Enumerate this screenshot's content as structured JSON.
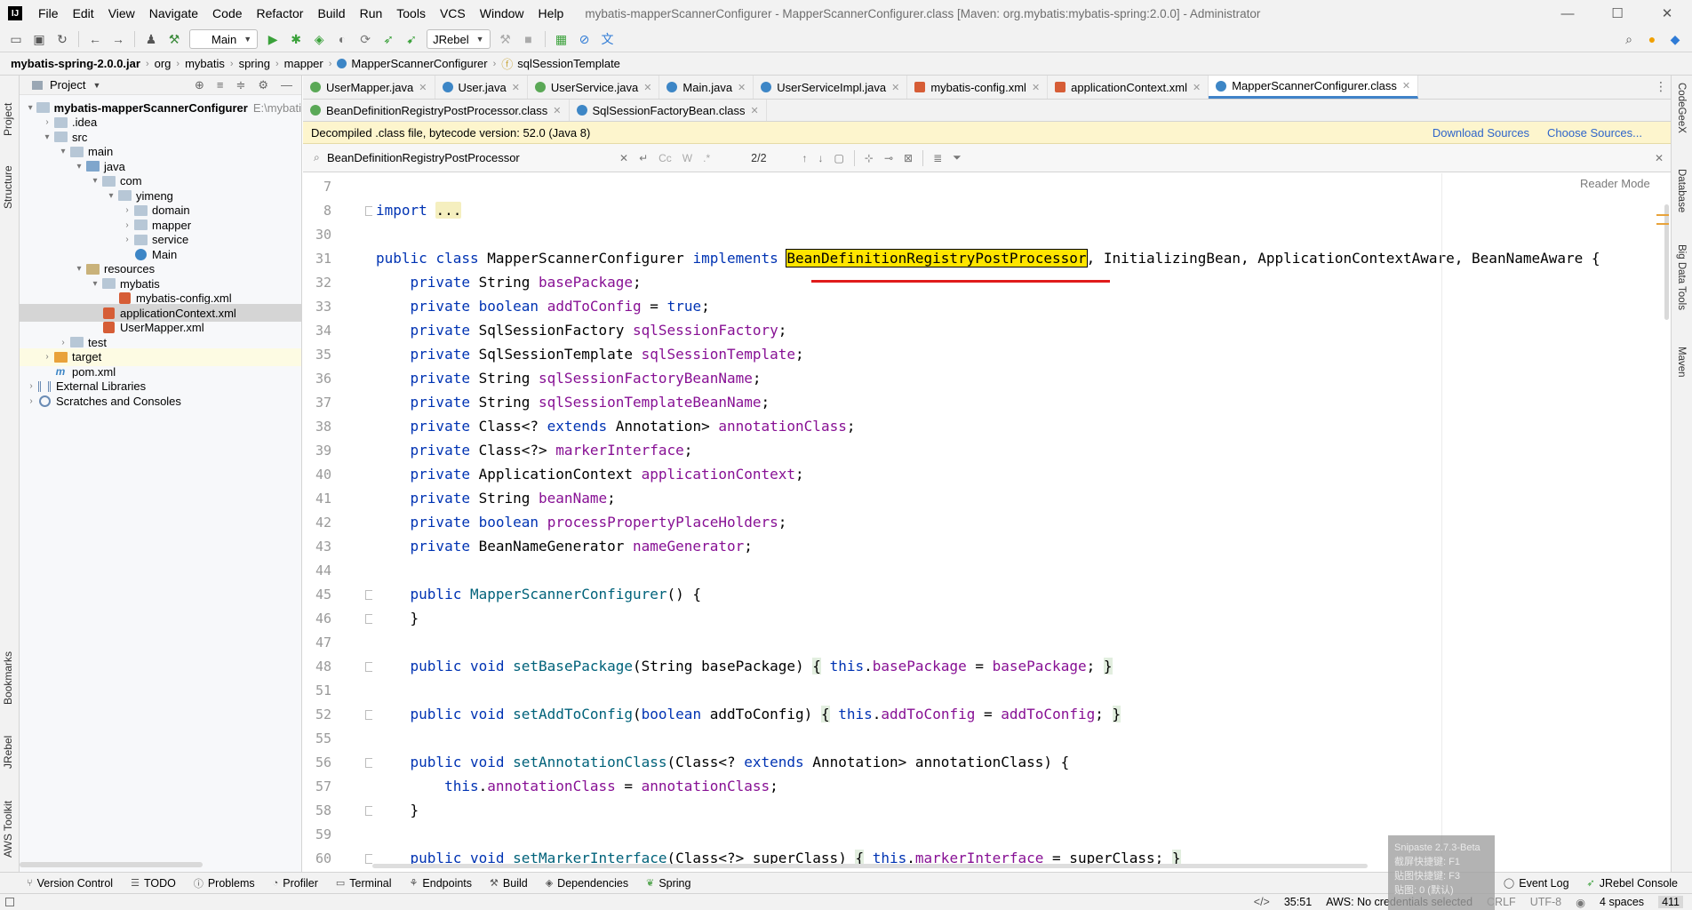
{
  "window": {
    "logo": "IJ",
    "title": "mybatis-mapperScannerConfigurer - MapperScannerConfigurer.class [Maven: org.mybatis:mybatis-spring:2.0.0] - Administrator",
    "controls": [
      "—",
      "☐",
      "✕"
    ]
  },
  "menu": [
    "File",
    "Edit",
    "View",
    "Navigate",
    "Code",
    "Refactor",
    "Build",
    "Run",
    "Tools",
    "VCS",
    "Window",
    "Help"
  ],
  "toolbar": {
    "run_config": "Main",
    "jrebel_config": "JRebel"
  },
  "breadcrumb": [
    "mybatis-spring-2.0.0.jar",
    "org",
    "mybatis",
    "spring",
    "mapper",
    "MapperScannerConfigurer",
    "sqlSessionTemplate"
  ],
  "left_stripe": [
    "Project",
    "Structure",
    "Bookmarks",
    "JRebel",
    "AWS Toolkit"
  ],
  "right_stripe": [
    "CodeGeeX",
    "Database",
    "Big Data Tools",
    "Maven"
  ],
  "project": {
    "header": "Project",
    "root_path": "E:\\mybati",
    "tree": [
      {
        "label": "mybatis-mapperScannerConfigurer",
        "level": 0,
        "arrow": "▾",
        "icon": "folder",
        "bold": true
      },
      {
        "label": ".idea",
        "level": 1,
        "arrow": "›",
        "icon": "folder"
      },
      {
        "label": "src",
        "level": 1,
        "arrow": "▾",
        "icon": "folder"
      },
      {
        "label": "main",
        "level": 2,
        "arrow": "▾",
        "icon": "folder"
      },
      {
        "label": "java",
        "level": 3,
        "arrow": "▾",
        "icon": "folder-src"
      },
      {
        "label": "com",
        "level": 4,
        "arrow": "▾",
        "icon": "folder"
      },
      {
        "label": "yimeng",
        "level": 5,
        "arrow": "▾",
        "icon": "folder"
      },
      {
        "label": "domain",
        "level": 6,
        "arrow": "›",
        "icon": "folder"
      },
      {
        "label": "mapper",
        "level": 6,
        "arrow": "›",
        "icon": "folder"
      },
      {
        "label": "service",
        "level": 6,
        "arrow": "›",
        "icon": "folder"
      },
      {
        "label": "Main",
        "level": 6,
        "arrow": "",
        "icon": "class"
      },
      {
        "label": "resources",
        "level": 3,
        "arrow": "▾",
        "icon": "folder-res"
      },
      {
        "label": "mybatis",
        "level": 4,
        "arrow": "▾",
        "icon": "folder"
      },
      {
        "label": "mybatis-config.xml",
        "level": 5,
        "arrow": "",
        "icon": "xml"
      },
      {
        "label": "applicationContext.xml",
        "level": 4,
        "arrow": "",
        "icon": "xml",
        "selected": true
      },
      {
        "label": "UserMapper.xml",
        "level": 4,
        "arrow": "",
        "icon": "xml"
      },
      {
        "label": "test",
        "level": 2,
        "arrow": "›",
        "icon": "folder"
      },
      {
        "label": "target",
        "level": 1,
        "arrow": "›",
        "icon": "folder-orange",
        "hilite": true
      },
      {
        "label": "pom.xml",
        "level": 1,
        "arrow": "",
        "icon": "maven"
      },
      {
        "label": "External Libraries",
        "level": 0,
        "arrow": "›",
        "icon": "lib"
      },
      {
        "label": "Scratches and Consoles",
        "level": 0,
        "arrow": "›",
        "icon": "scratch"
      }
    ]
  },
  "tabs_row1": [
    {
      "label": "UserMapper.java",
      "icon": "ti-i"
    },
    {
      "label": "User.java",
      "icon": "ti-c"
    },
    {
      "label": "UserService.java",
      "icon": "ti-i"
    },
    {
      "label": "Main.java",
      "icon": "ti-c"
    },
    {
      "label": "UserServiceImpl.java",
      "icon": "ti-c"
    },
    {
      "label": "mybatis-config.xml",
      "icon": "ti-x"
    },
    {
      "label": "applicationContext.xml",
      "icon": "ti-x"
    },
    {
      "label": "MapperScannerConfigurer.class",
      "icon": "ti-c",
      "active": true
    }
  ],
  "tabs_row2": [
    {
      "label": "BeanDefinitionRegistryPostProcessor.class",
      "icon": "ti-i"
    },
    {
      "label": "SqlSessionFactoryBean.class",
      "icon": "ti-c"
    }
  ],
  "banner": {
    "text": "Decompiled .class file, bytecode version: 52.0 (Java 8)",
    "download": "Download Sources",
    "choose": "Choose Sources..."
  },
  "search": {
    "value": "BeanDefinitionRegistryPostProcessor",
    "match_count": "2/2",
    "opt_case": "Cc",
    "opt_word": "W",
    "opt_regex": ".*"
  },
  "editor": {
    "reader_mode": "Reader Mode",
    "current_line": "35",
    "lines": [
      {
        "n": "7",
        "code": ""
      },
      {
        "n": "8",
        "code": "import ..."
      },
      {
        "n": "30",
        "code": ""
      },
      {
        "n": "31",
        "code": "public class MapperScannerConfigurer implements BeanDefinitionRegistryPostProcessor, InitializingBean, ApplicationContextAware, BeanNameAware {"
      },
      {
        "n": "32",
        "code": "    private String basePackage;"
      },
      {
        "n": "33",
        "code": "    private boolean addToConfig = true;"
      },
      {
        "n": "34",
        "code": "    private SqlSessionFactory sqlSessionFactory;"
      },
      {
        "n": "35",
        "code": "    private SqlSessionTemplate sqlSessionTemplate;"
      },
      {
        "n": "36",
        "code": "    private String sqlSessionFactoryBeanName;"
      },
      {
        "n": "37",
        "code": "    private String sqlSessionTemplateBeanName;"
      },
      {
        "n": "38",
        "code": "    private Class<? extends Annotation> annotationClass;"
      },
      {
        "n": "39",
        "code": "    private Class<?> markerInterface;"
      },
      {
        "n": "40",
        "code": "    private ApplicationContext applicationContext;"
      },
      {
        "n": "41",
        "code": "    private String beanName;"
      },
      {
        "n": "42",
        "code": "    private boolean processPropertyPlaceHolders;"
      },
      {
        "n": "43",
        "code": "    private BeanNameGenerator nameGenerator;"
      },
      {
        "n": "44",
        "code": ""
      },
      {
        "n": "45",
        "code": "    public MapperScannerConfigurer() {"
      },
      {
        "n": "46",
        "code": "    }"
      },
      {
        "n": "47",
        "code": ""
      },
      {
        "n": "48",
        "code": "    public void setBasePackage(String basePackage) { this.basePackage = basePackage; }"
      },
      {
        "n": "51",
        "code": ""
      },
      {
        "n": "52",
        "code": "    public void setAddToConfig(boolean addToConfig) { this.addToConfig = addToConfig; }"
      },
      {
        "n": "55",
        "code": ""
      },
      {
        "n": "56",
        "code": "    public void setAnnotationClass(Class<? extends Annotation> annotationClass) {"
      },
      {
        "n": "57",
        "code": "        this.annotationClass = annotationClass;"
      },
      {
        "n": "58",
        "code": "    }"
      },
      {
        "n": "59",
        "code": ""
      },
      {
        "n": "60",
        "code": "    public void setMarkerInterface(Class<?> superClass) { this.markerInterface = superClass; }"
      }
    ]
  },
  "bottom_tools": [
    "Version Control",
    "TODO",
    "Problems",
    "Profiler",
    "Terminal",
    "Endpoints",
    "Build",
    "Dependencies",
    "Spring"
  ],
  "bottom_right_tools": [
    "Event Log",
    "JRebel Console"
  ],
  "status": {
    "position": "35:51",
    "aws": "AWS: No credentials selected",
    "line_sep": "CRLF",
    "encoding": "UTF-8",
    "indent": "4 spaces",
    "memory": "411"
  },
  "snipaste": {
    "title": "Snipaste 2.7.3-Beta",
    "line1": "截屏快捷键: F1",
    "line2": "贴图快捷键: F3",
    "line3": "贴图: 0 (默认)"
  },
  "colors": {
    "keyword": "#0033b3",
    "field": "#871094",
    "method": "#00627a",
    "search_highlight": "#ffe500",
    "underline": "#e01b1b",
    "banner": "#fdf5cd"
  }
}
